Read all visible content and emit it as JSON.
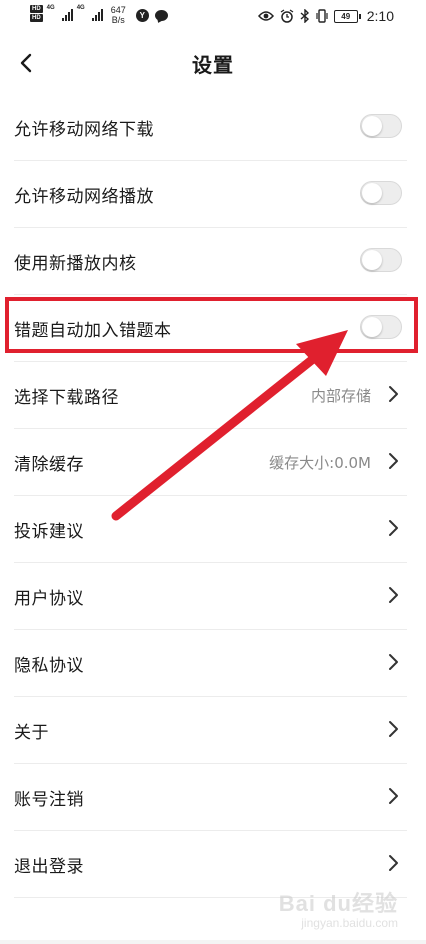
{
  "status_bar": {
    "net_label_1": "4G",
    "net_label_2": "4G",
    "speed_value": "647",
    "speed_unit": "B/s",
    "y_badge": "Y",
    "battery_level": "49",
    "time": "2:10"
  },
  "header": {
    "title": "设置"
  },
  "settings": [
    {
      "label": "允许移动网络下载",
      "toggle": "off"
    },
    {
      "label": "允许移动网络播放",
      "toggle": "off"
    },
    {
      "label": "使用新播放内核",
      "toggle": "off"
    },
    {
      "label": "错题自动加入错题本",
      "toggle": "off"
    },
    {
      "label": "选择下载路径",
      "value": "内部存储"
    },
    {
      "label": "清除缓存",
      "value": "缓存大小:0.0M"
    },
    {
      "label": "投诉建议"
    },
    {
      "label": "用户协议"
    },
    {
      "label": "隐私协议"
    },
    {
      "label": "关于"
    },
    {
      "label": "账号注销"
    },
    {
      "label": "退出登录"
    }
  ],
  "annotation": {
    "highlight_color": "#e0202e"
  },
  "watermark": {
    "text": "Bai du经验",
    "sub": "jingyan.baidu.com"
  }
}
